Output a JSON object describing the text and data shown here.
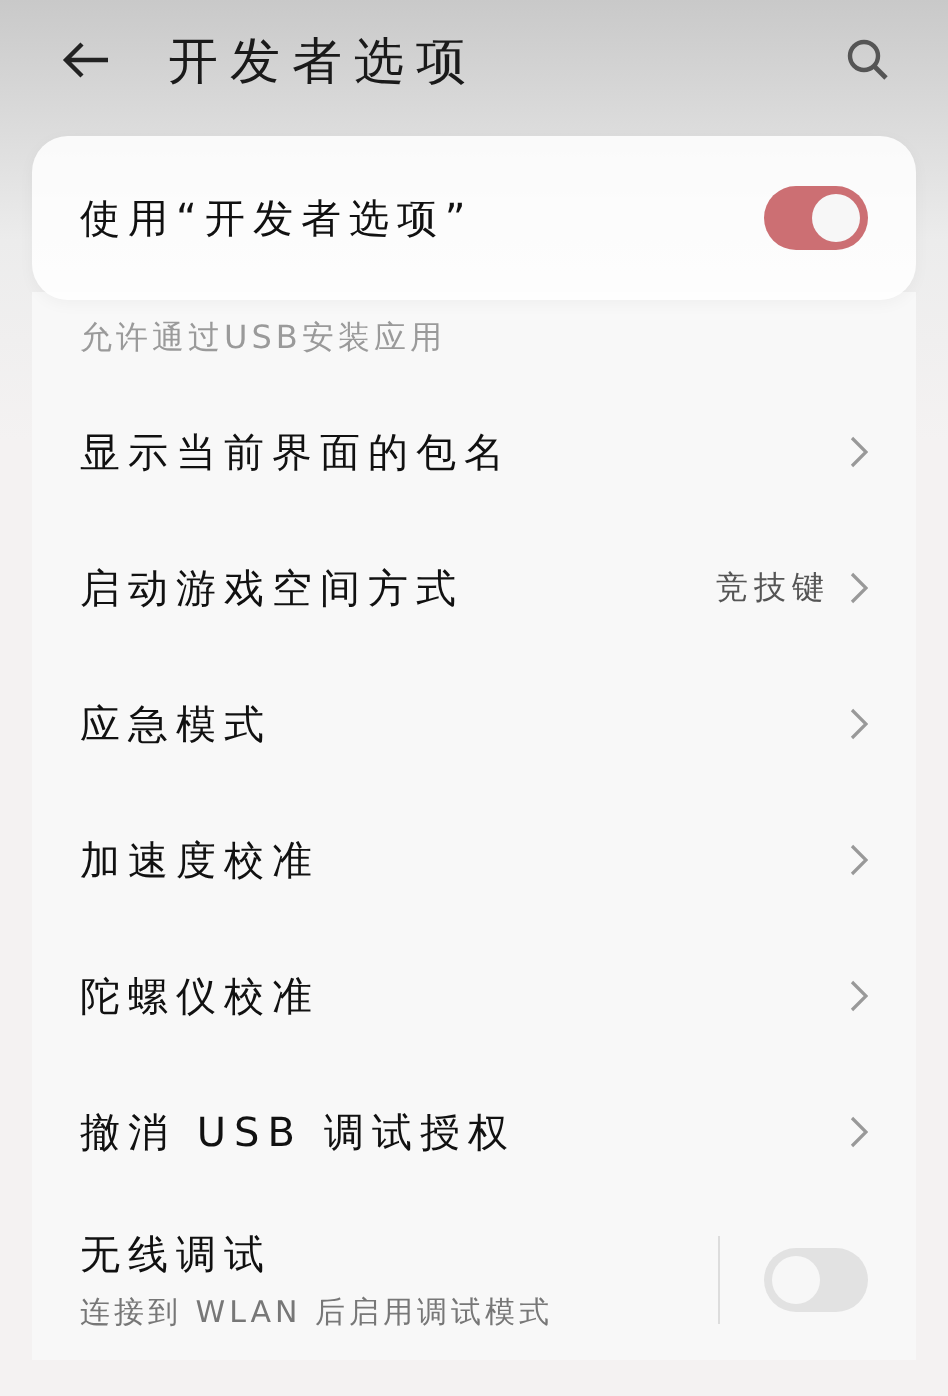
{
  "header": {
    "title": "开发者选项"
  },
  "master_switch": {
    "label": "使用“开发者选项”",
    "on": true
  },
  "faded_row": {
    "label": "允许通过USB安装应用"
  },
  "items": [
    {
      "kind": "nav",
      "label": "显示当前界面的包名"
    },
    {
      "kind": "nav",
      "label": "启动游戏空间方式",
      "value": "竞技键"
    },
    {
      "kind": "nav",
      "label": "应急模式"
    },
    {
      "kind": "nav",
      "label": "加速度校准"
    },
    {
      "kind": "nav",
      "label": "陀螺仪校准"
    },
    {
      "kind": "nav",
      "label": "撤消 USB 调试授权"
    },
    {
      "kind": "toggle",
      "label": "无线调试",
      "subtitle": "连接到 WLAN 后启用调试模式",
      "on": false
    }
  ]
}
